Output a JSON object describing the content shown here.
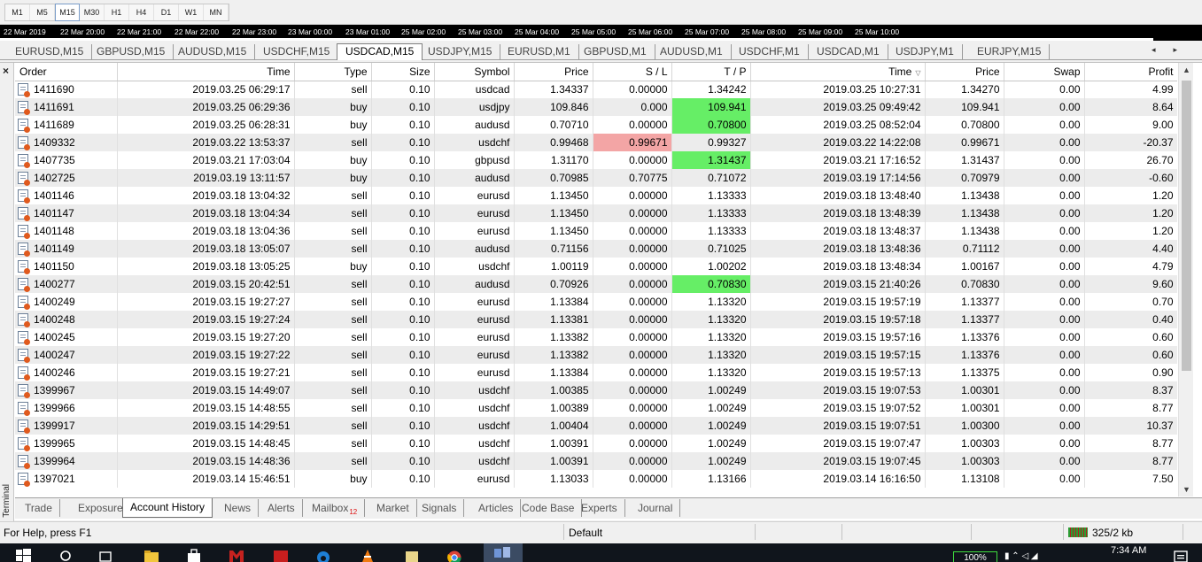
{
  "toolbar": {
    "timeframes": [
      "M1",
      "M5",
      "M15",
      "M30",
      "H1",
      "H4",
      "D1",
      "W1",
      "MN"
    ],
    "active_timeframe": "M15"
  },
  "chart": {
    "time_axis": [
      "22 Mar 2019",
      "22 Mar 20:00",
      "22 Mar 21:00",
      "22 Mar 22:00",
      "22 Mar 23:00",
      "23 Mar 00:00",
      "23 Mar 01:00",
      "25 Mar 02:00",
      "25 Mar 03:00",
      "25 Mar 04:00",
      "25 Mar 05:00",
      "25 Mar 06:00",
      "25 Mar 07:00",
      "25 Mar 08:00",
      "25 Mar 09:00",
      "25 Mar 10:00"
    ],
    "tabs": [
      "EURUSD,M15",
      "GBPUSD,M15",
      "AUDUSD,M15",
      "USDCHF,M15",
      "USDCAD,M15",
      "USDJPY,M15",
      "EURUSD,M1",
      "GBPUSD,M1",
      "AUDUSD,M1",
      "USDCHF,M1",
      "USDCAD,M1",
      "USDJPY,M1",
      "EURJPY,M15"
    ],
    "active_tab": "USDCAD,M15"
  },
  "terminal": {
    "side_label": "Terminal",
    "close_symbol": "×",
    "columns": [
      "Order",
      "Time",
      "Type",
      "Size",
      "Symbol",
      "Price",
      "S / L",
      "T / P",
      "Time",
      "Price",
      "Swap",
      "Profit"
    ],
    "sorted_column_marker": "▽",
    "rows": [
      {
        "order": "1411690",
        "open_time": "2019.03.25 06:29:17",
        "type": "sell",
        "size": "0.10",
        "symbol": "usdcad",
        "open_price": "1.34337",
        "sl": "0.00000",
        "tp": "1.34242",
        "close_time": "2019.03.25 10:27:31",
        "close_price": "1.34270",
        "swap": "0.00",
        "profit": "4.99",
        "hl": ""
      },
      {
        "order": "1411691",
        "open_time": "2019.03.25 06:29:36",
        "type": "buy",
        "size": "0.10",
        "symbol": "usdjpy",
        "open_price": "109.846",
        "sl": "0.000",
        "tp": "109.941",
        "close_time": "2019.03.25 09:49:42",
        "close_price": "109.941",
        "swap": "0.00",
        "profit": "8.64",
        "hl": "tp"
      },
      {
        "order": "1411689",
        "open_time": "2019.03.25 06:28:31",
        "type": "buy",
        "size": "0.10",
        "symbol": "audusd",
        "open_price": "0.70710",
        "sl": "0.00000",
        "tp": "0.70800",
        "close_time": "2019.03.25 08:52:04",
        "close_price": "0.70800",
        "swap": "0.00",
        "profit": "9.00",
        "hl": "tp"
      },
      {
        "order": "1409332",
        "open_time": "2019.03.22 13:53:37",
        "type": "sell",
        "size": "0.10",
        "symbol": "usdchf",
        "open_price": "0.99468",
        "sl": "0.99671",
        "tp": "0.99327",
        "close_time": "2019.03.22 14:22:08",
        "close_price": "0.99671",
        "swap": "0.00",
        "profit": "-20.37",
        "hl": "sl"
      },
      {
        "order": "1407735",
        "open_time": "2019.03.21 17:03:04",
        "type": "buy",
        "size": "0.10",
        "symbol": "gbpusd",
        "open_price": "1.31170",
        "sl": "0.00000",
        "tp": "1.31437",
        "close_time": "2019.03.21 17:16:52",
        "close_price": "1.31437",
        "swap": "0.00",
        "profit": "26.70",
        "hl": "tp"
      },
      {
        "order": "1402725",
        "open_time": "2019.03.19 13:11:57",
        "type": "buy",
        "size": "0.10",
        "symbol": "audusd",
        "open_price": "0.70985",
        "sl": "0.70775",
        "tp": "0.71072",
        "close_time": "2019.03.19 17:14:56",
        "close_price": "0.70979",
        "swap": "0.00",
        "profit": "-0.60",
        "hl": ""
      },
      {
        "order": "1401146",
        "open_time": "2019.03.18 13:04:32",
        "type": "sell",
        "size": "0.10",
        "symbol": "eurusd",
        "open_price": "1.13450",
        "sl": "0.00000",
        "tp": "1.13333",
        "close_time": "2019.03.18 13:48:40",
        "close_price": "1.13438",
        "swap": "0.00",
        "profit": "1.20",
        "hl": ""
      },
      {
        "order": "1401147",
        "open_time": "2019.03.18 13:04:34",
        "type": "sell",
        "size": "0.10",
        "symbol": "eurusd",
        "open_price": "1.13450",
        "sl": "0.00000",
        "tp": "1.13333",
        "close_time": "2019.03.18 13:48:39",
        "close_price": "1.13438",
        "swap": "0.00",
        "profit": "1.20",
        "hl": ""
      },
      {
        "order": "1401148",
        "open_time": "2019.03.18 13:04:36",
        "type": "sell",
        "size": "0.10",
        "symbol": "eurusd",
        "open_price": "1.13450",
        "sl": "0.00000",
        "tp": "1.13333",
        "close_time": "2019.03.18 13:48:37",
        "close_price": "1.13438",
        "swap": "0.00",
        "profit": "1.20",
        "hl": ""
      },
      {
        "order": "1401149",
        "open_time": "2019.03.18 13:05:07",
        "type": "sell",
        "size": "0.10",
        "symbol": "audusd",
        "open_price": "0.71156",
        "sl": "0.00000",
        "tp": "0.71025",
        "close_time": "2019.03.18 13:48:36",
        "close_price": "0.71112",
        "swap": "0.00",
        "profit": "4.40",
        "hl": ""
      },
      {
        "order": "1401150",
        "open_time": "2019.03.18 13:05:25",
        "type": "buy",
        "size": "0.10",
        "symbol": "usdchf",
        "open_price": "1.00119",
        "sl": "0.00000",
        "tp": "1.00202",
        "close_time": "2019.03.18 13:48:34",
        "close_price": "1.00167",
        "swap": "0.00",
        "profit": "4.79",
        "hl": ""
      },
      {
        "order": "1400277",
        "open_time": "2019.03.15 20:42:51",
        "type": "sell",
        "size": "0.10",
        "symbol": "audusd",
        "open_price": "0.70926",
        "sl": "0.00000",
        "tp": "0.70830",
        "close_time": "2019.03.15 21:40:26",
        "close_price": "0.70830",
        "swap": "0.00",
        "profit": "9.60",
        "hl": "tp"
      },
      {
        "order": "1400249",
        "open_time": "2019.03.15 19:27:27",
        "type": "sell",
        "size": "0.10",
        "symbol": "eurusd",
        "open_price": "1.13384",
        "sl": "0.00000",
        "tp": "1.13320",
        "close_time": "2019.03.15 19:57:19",
        "close_price": "1.13377",
        "swap": "0.00",
        "profit": "0.70",
        "hl": ""
      },
      {
        "order": "1400248",
        "open_time": "2019.03.15 19:27:24",
        "type": "sell",
        "size": "0.10",
        "symbol": "eurusd",
        "open_price": "1.13381",
        "sl": "0.00000",
        "tp": "1.13320",
        "close_time": "2019.03.15 19:57:18",
        "close_price": "1.13377",
        "swap": "0.00",
        "profit": "0.40",
        "hl": ""
      },
      {
        "order": "1400245",
        "open_time": "2019.03.15 19:27:20",
        "type": "sell",
        "size": "0.10",
        "symbol": "eurusd",
        "open_price": "1.13382",
        "sl": "0.00000",
        "tp": "1.13320",
        "close_time": "2019.03.15 19:57:16",
        "close_price": "1.13376",
        "swap": "0.00",
        "profit": "0.60",
        "hl": ""
      },
      {
        "order": "1400247",
        "open_time": "2019.03.15 19:27:22",
        "type": "sell",
        "size": "0.10",
        "symbol": "eurusd",
        "open_price": "1.13382",
        "sl": "0.00000",
        "tp": "1.13320",
        "close_time": "2019.03.15 19:57:15",
        "close_price": "1.13376",
        "swap": "0.00",
        "profit": "0.60",
        "hl": ""
      },
      {
        "order": "1400246",
        "open_time": "2019.03.15 19:27:21",
        "type": "sell",
        "size": "0.10",
        "symbol": "eurusd",
        "open_price": "1.13384",
        "sl": "0.00000",
        "tp": "1.13320",
        "close_time": "2019.03.15 19:57:13",
        "close_price": "1.13375",
        "swap": "0.00",
        "profit": "0.90",
        "hl": ""
      },
      {
        "order": "1399967",
        "open_time": "2019.03.15 14:49:07",
        "type": "sell",
        "size": "0.10",
        "symbol": "usdchf",
        "open_price": "1.00385",
        "sl": "0.00000",
        "tp": "1.00249",
        "close_time": "2019.03.15 19:07:53",
        "close_price": "1.00301",
        "swap": "0.00",
        "profit": "8.37",
        "hl": ""
      },
      {
        "order": "1399966",
        "open_time": "2019.03.15 14:48:55",
        "type": "sell",
        "size": "0.10",
        "symbol": "usdchf",
        "open_price": "1.00389",
        "sl": "0.00000",
        "tp": "1.00249",
        "close_time": "2019.03.15 19:07:52",
        "close_price": "1.00301",
        "swap": "0.00",
        "profit": "8.77",
        "hl": ""
      },
      {
        "order": "1399917",
        "open_time": "2019.03.15 14:29:51",
        "type": "sell",
        "size": "0.10",
        "symbol": "usdchf",
        "open_price": "1.00404",
        "sl": "0.00000",
        "tp": "1.00249",
        "close_time": "2019.03.15 19:07:51",
        "close_price": "1.00300",
        "swap": "0.00",
        "profit": "10.37",
        "hl": ""
      },
      {
        "order": "1399965",
        "open_time": "2019.03.15 14:48:45",
        "type": "sell",
        "size": "0.10",
        "symbol": "usdchf",
        "open_price": "1.00391",
        "sl": "0.00000",
        "tp": "1.00249",
        "close_time": "2019.03.15 19:07:47",
        "close_price": "1.00303",
        "swap": "0.00",
        "profit": "8.77",
        "hl": ""
      },
      {
        "order": "1399964",
        "open_time": "2019.03.15 14:48:36",
        "type": "sell",
        "size": "0.10",
        "symbol": "usdchf",
        "open_price": "1.00391",
        "sl": "0.00000",
        "tp": "1.00249",
        "close_time": "2019.03.15 19:07:45",
        "close_price": "1.00303",
        "swap": "0.00",
        "profit": "8.77",
        "hl": ""
      },
      {
        "order": "1397021",
        "open_time": "2019.03.14 15:46:51",
        "type": "buy",
        "size": "0.10",
        "symbol": "eurusd",
        "open_price": "1.13033",
        "sl": "0.00000",
        "tp": "1.13166",
        "close_time": "2019.03.14 16:16:50",
        "close_price": "1.13108",
        "swap": "0.00",
        "profit": "7.50",
        "hl": ""
      }
    ],
    "highlight_colors": {
      "tp": "#66ee66",
      "sl": "#f3a5a5"
    },
    "tabs": [
      {
        "label": "Trade"
      },
      {
        "label": "Exposure"
      },
      {
        "label": "Account History"
      },
      {
        "label": "News"
      },
      {
        "label": "Alerts"
      },
      {
        "label": "Mailbox",
        "badge": "12"
      },
      {
        "label": "Market"
      },
      {
        "label": "Signals"
      },
      {
        "label": "Articles"
      },
      {
        "label": "Code Base"
      },
      {
        "label": "Experts"
      },
      {
        "label": "Journal"
      }
    ],
    "active_tab": "Account History"
  },
  "status_bar": {
    "help_text": "For Help, press F1",
    "profile": "Default",
    "traffic": "325/2 kb"
  },
  "taskbar": {
    "battery": "100%",
    "clock": "7:34 AM"
  }
}
